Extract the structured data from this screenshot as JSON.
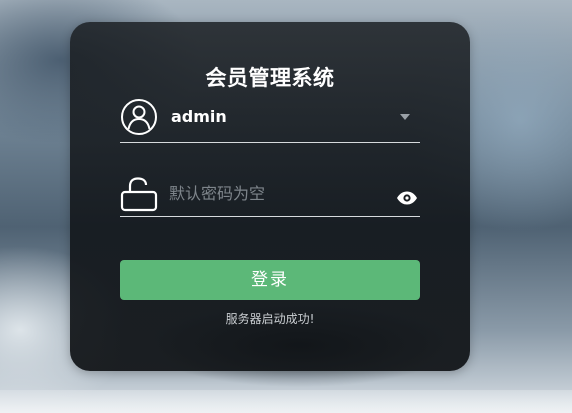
{
  "app": {
    "title": "会员管理系统"
  },
  "login_form": {
    "username": {
      "value": "admin",
      "icon": "user-circle-icon",
      "dropdown_icon": "caret-down-icon"
    },
    "password": {
      "value": "",
      "placeholder": "默认密码为空",
      "icon": "lock-icon",
      "toggle_icon": "eye-icon"
    },
    "submit_label": "登录",
    "status_message": "服务器启动成功!"
  },
  "colors": {
    "accent": "#5cb878",
    "panel": "#1b1f23",
    "text": "#ffffff"
  }
}
